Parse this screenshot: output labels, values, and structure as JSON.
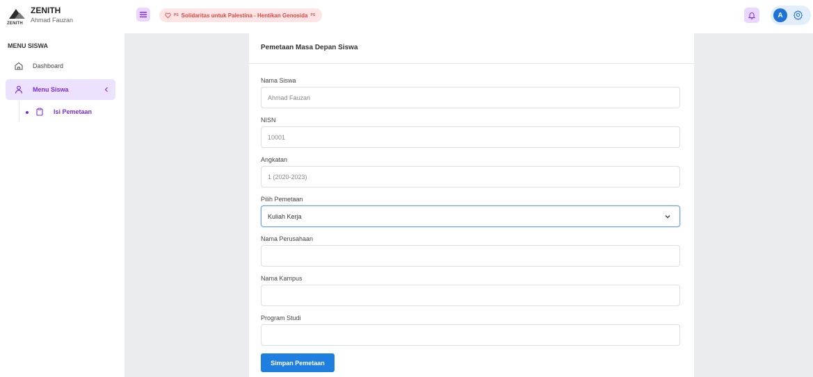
{
  "brand": {
    "name": "ZENITH",
    "logo_text": "ZENITH",
    "user_name": "Ahmad Fauzan"
  },
  "header": {
    "banner_prefix": "PS",
    "banner_text": "Solidaritas untuk Palestina - Hentikan Genosida",
    "banner_suffix": "PS",
    "avatar_initial": "A"
  },
  "sidebar": {
    "section_title": "MENU SISWA",
    "items": [
      {
        "label": "Dashboard",
        "icon": "home-icon"
      },
      {
        "label": "Menu Siswa",
        "icon": "user-icon",
        "active": true
      },
      {
        "label": "Isi Pemetaan",
        "icon": "clipboard-icon",
        "active": true
      }
    ]
  },
  "form": {
    "title": "Pemetaan Masa Depan Siswa",
    "fields": [
      {
        "label": "Nama Siswa",
        "value": "Ahmad Fauzan"
      },
      {
        "label": "NISN",
        "value": "10001"
      },
      {
        "label": "Angkatan",
        "value": "1 (2020-2023)"
      },
      {
        "label": "Pilih Pemetaan",
        "value": "Kuliah Kerja"
      },
      {
        "label": "Nama Perusahaan",
        "value": ""
      },
      {
        "label": "Nama Kampus",
        "value": ""
      },
      {
        "label": "Program Studi",
        "value": ""
      }
    ],
    "submit_label": "Simpan Pemetaan"
  },
  "colors": {
    "accent_purple": "#7a2be2",
    "primary_blue": "#1f7fe0",
    "banner_red": "#e0443e"
  }
}
